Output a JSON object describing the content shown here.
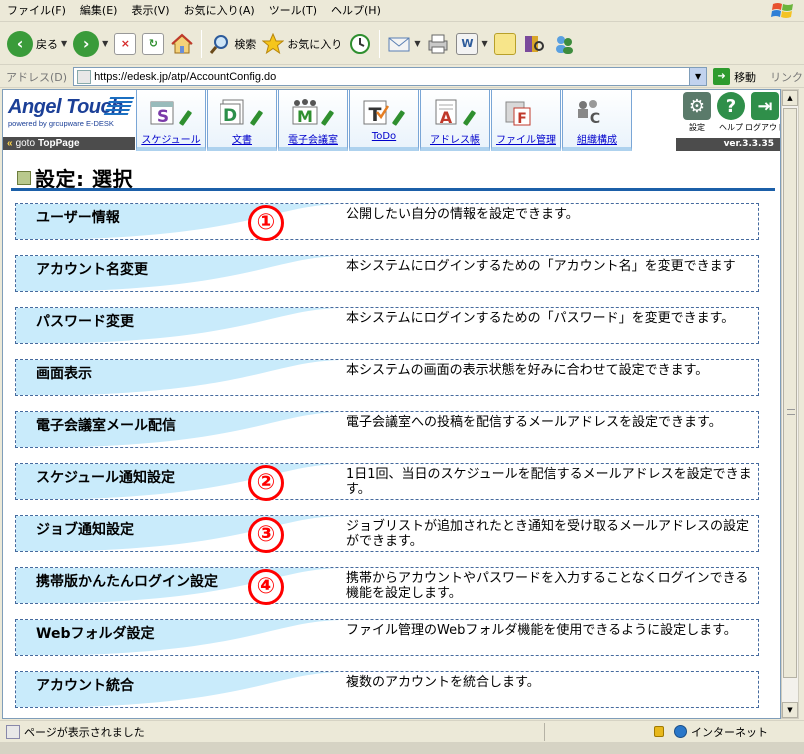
{
  "menu": {
    "items": [
      "ファイル(F)",
      "編集(E)",
      "表示(V)",
      "お気に入り(A)",
      "ツール(T)",
      "ヘルプ(H)"
    ]
  },
  "toolbar": {
    "back_label": "戻る",
    "search_label": "検索",
    "favorites_label": "お気に入り"
  },
  "address": {
    "label": "アドレス(D)",
    "url": "https://edesk.jp/atp/AccountConfig.do",
    "go_label": "移動",
    "links_label": "リンク"
  },
  "app": {
    "logo_text": "Angel Touch",
    "powered_by": "powered by grcupware E-DESK",
    "goto_prefix": "goto",
    "goto_label": "TopPage",
    "version": "ver.3.3.35",
    "modules": [
      {
        "label": "スケジュール",
        "letter": "S",
        "color": "#7a3aa8"
      },
      {
        "label": "文書",
        "letter": "D",
        "color": "#2c8f4a"
      },
      {
        "label": "電子会議室",
        "letter": "M",
        "color": "#2f8f2f"
      },
      {
        "label": "ToDo",
        "letter": "T",
        "color": "#333333"
      },
      {
        "label": "アドレス帳",
        "letter": "A",
        "color": "#c0392b"
      },
      {
        "label": "ファイル管理",
        "letter": "F",
        "color": "#c0392b"
      },
      {
        "label": "組織構成",
        "letter": "C",
        "color": "#555555"
      }
    ],
    "system": [
      {
        "label": "設定",
        "glyph": "⚙"
      },
      {
        "label": "ヘルプ",
        "glyph": "?"
      },
      {
        "label": "ログアウト",
        "glyph": "⇥"
      }
    ]
  },
  "page": {
    "title": "設定: 選択"
  },
  "settings": [
    {
      "name": "ユーザー情報",
      "desc": "公開したい自分の情報を設定できます。",
      "badge": "①"
    },
    {
      "name": "アカウント名変更",
      "desc": "本システムにログインするための「アカウント名」を変更できます",
      "badge": ""
    },
    {
      "name": "パスワード変更",
      "desc": "本システムにログインするための「パスワード」を変更できます。",
      "badge": ""
    },
    {
      "name": "画面表示",
      "desc": "本システムの画面の表示状態を好みに合わせて設定できます。",
      "badge": ""
    },
    {
      "name": "電子会議室メール配信",
      "desc": "電子会議室への投稿を配信するメールアドレスを設定できます。",
      "badge": ""
    },
    {
      "name": "スケジュール通知設定",
      "desc": "1日1回、当日のスケジュールを配信するメールアドレスを設定できます。",
      "badge": "②"
    },
    {
      "name": "ジョブ通知設定",
      "desc": "ジョブリストが追加されたとき通知を受け取るメールアドレスの設定ができます。",
      "badge": "③"
    },
    {
      "name": "携帯版かんたんログイン設定",
      "desc": "携帯からアカウントやパスワードを入力することなくログインできる機能を設定します。",
      "badge": "④"
    },
    {
      "name": "Webフォルダ設定",
      "desc": "ファイル管理のWebフォルダ機能を使用できるように設定します。",
      "badge": ""
    },
    {
      "name": "アカウント統合",
      "desc": "複数のアカウントを統合します。",
      "badge": ""
    }
  ],
  "status": {
    "text": "ページが表示されました",
    "zone": "インターネット"
  },
  "colors": {
    "wave": "#c9ebfb",
    "row_border": "#456a9e",
    "badge": "#ff0000",
    "title_rule": "#1b5fa8"
  }
}
